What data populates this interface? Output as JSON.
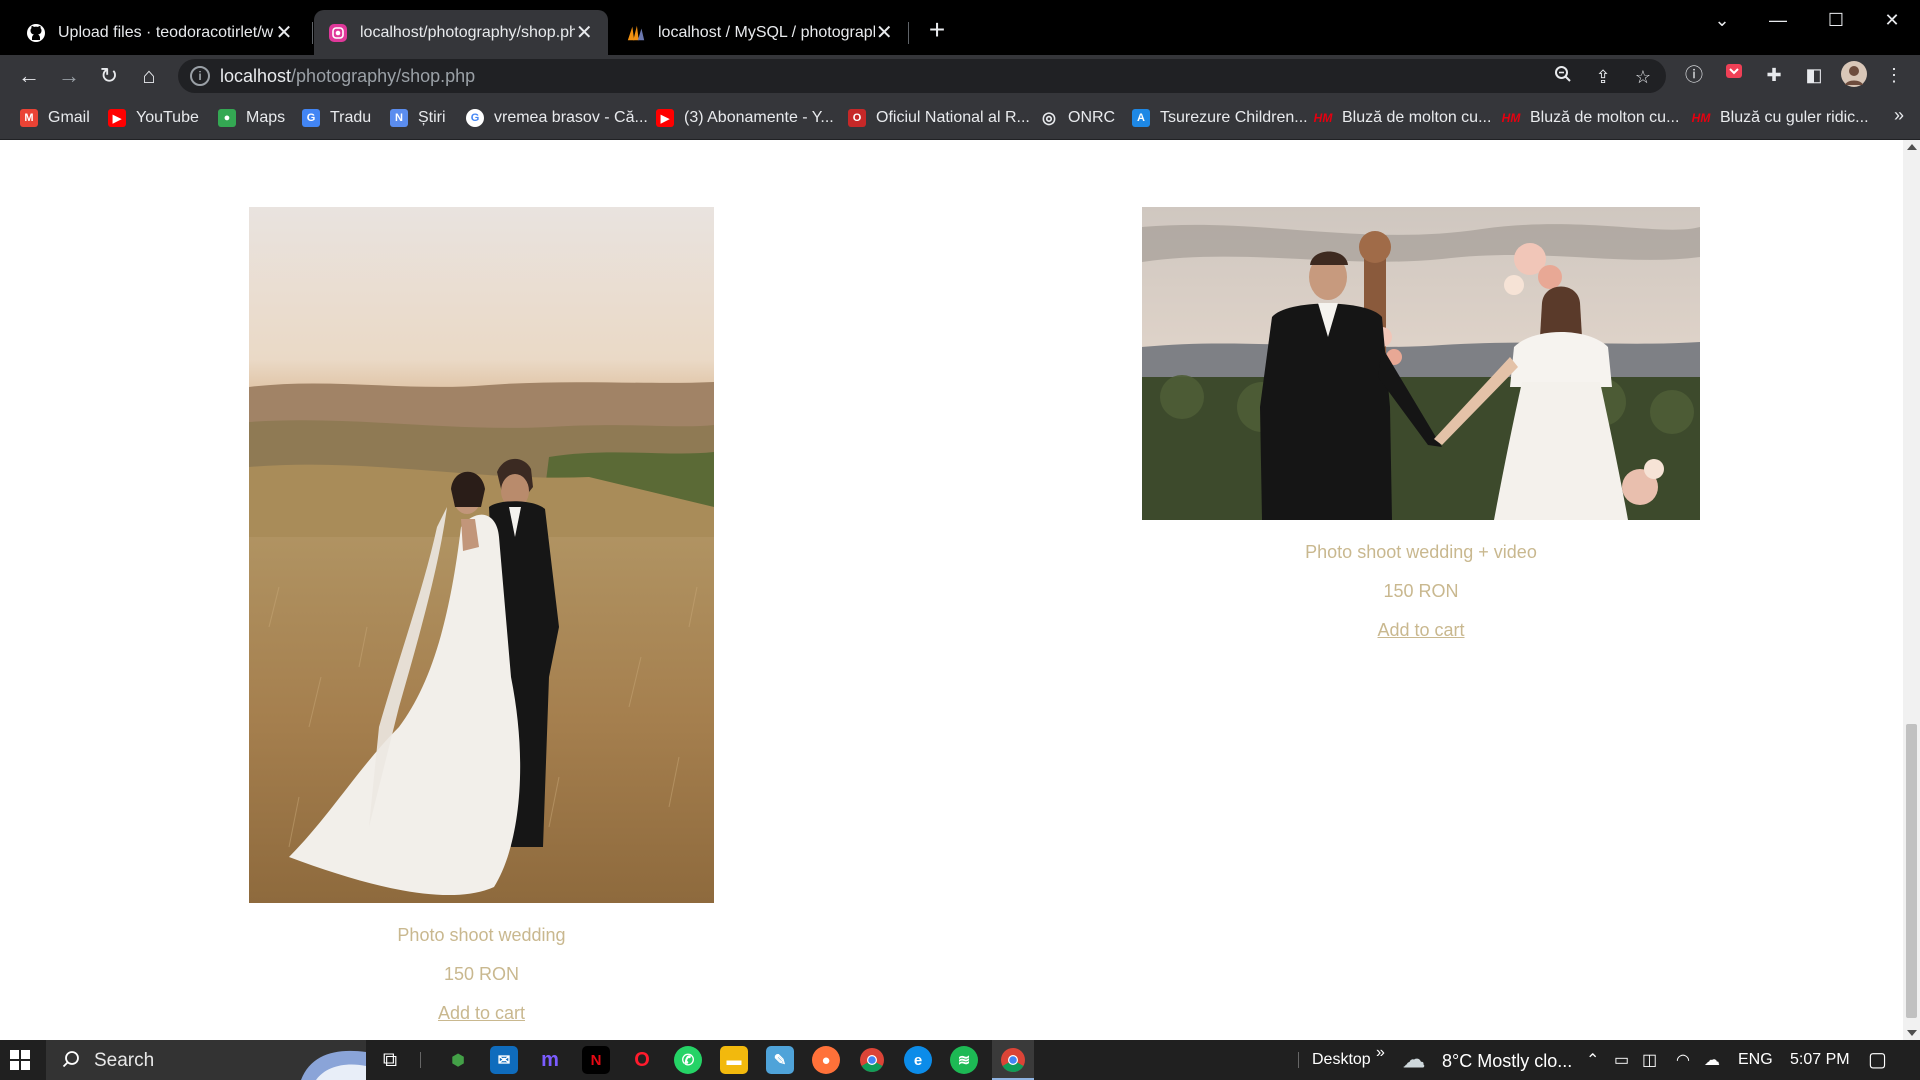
{
  "browser": {
    "tabs": [
      {
        "title": "Upload files · teodoracotirlet/web",
        "favicon": "github-icon",
        "active": false
      },
      {
        "title": "localhost/photography/shop.php",
        "favicon": "page-favicon-icon",
        "active": true
      },
      {
        "title": "localhost / MySQL / photography",
        "favicon": "phpmyadmin-icon",
        "active": false
      }
    ],
    "url_host": "localhost",
    "url_path": "/photography/shop.php",
    "bookmarks": [
      {
        "label": "Gmail",
        "icon": "gmail-icon",
        "color": "#ea4335",
        "glyph": "M"
      },
      {
        "label": "YouTube",
        "icon": "youtube-icon",
        "color": "#ff0000",
        "glyph": "▶"
      },
      {
        "label": "Maps",
        "icon": "maps-icon",
        "color": "#34a853",
        "glyph": "●"
      },
      {
        "label": "Tradu",
        "icon": "translate-icon",
        "color": "#4285f4",
        "glyph": "G"
      },
      {
        "label": "Știri",
        "icon": "news-icon",
        "color": "#5b8def",
        "glyph": "N"
      },
      {
        "label": "vremea brasov - Că...",
        "icon": "google-icon",
        "color": "#ffffff",
        "glyph": "G"
      },
      {
        "label": "(3) Abonamente - Y...",
        "icon": "youtube-icon",
        "color": "#ff0000",
        "glyph": "▶"
      },
      {
        "label": "Oficiul National al R...",
        "icon": "onrc-icon",
        "color": "#c62828",
        "glyph": "O"
      },
      {
        "label": "ONRC",
        "icon": "globe-icon",
        "color": "#9aa0a6",
        "glyph": "◎"
      },
      {
        "label": "Tsurezure Children...",
        "icon": "anime-icon",
        "color": "#1e88e5",
        "glyph": "A"
      },
      {
        "label": "Bluză de molton cu...",
        "icon": "hm-icon",
        "color": "#e50010",
        "glyph": "HM"
      },
      {
        "label": "Bluză de molton cu...",
        "icon": "hm-icon",
        "color": "#e50010",
        "glyph": "HM"
      },
      {
        "label": "Bluză cu guler ridic...",
        "icon": "hm-icon",
        "color": "#e50010",
        "glyph": "HM"
      }
    ],
    "bookmarks_more": "»"
  },
  "products": [
    {
      "name": "Photo shoot wedding",
      "price": "150 RON",
      "cart_label": "Add to cart",
      "image": "wedding-couple-field-photo"
    },
    {
      "name": "Photo shoot wedding + video",
      "price": "150 RON",
      "cart_label": "Add to cart",
      "image": "wedding-couple-holding-hands-photo"
    }
  ],
  "taskbar": {
    "search_label": "Search",
    "desktop_label": "Desktop",
    "weather": "8°C  Mostly clo...",
    "language": "ENG",
    "time": "5:07 PM"
  },
  "colors": {
    "product_text": "#c9b88f",
    "chrome_dark": "#35363a"
  }
}
